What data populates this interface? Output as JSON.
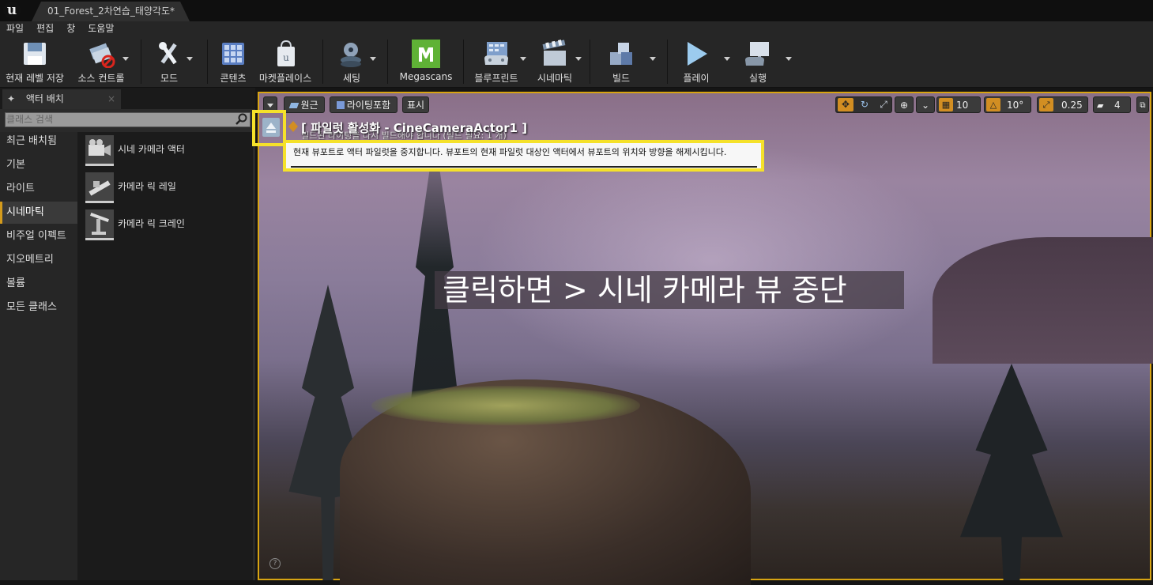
{
  "window": {
    "logo": "u",
    "doc_tab": "01_Forest_2차연습_태양각도*"
  },
  "menu": [
    "파일",
    "편집",
    "창",
    "도움말"
  ],
  "toolbar": {
    "save": "현재 레벨 저장",
    "source_control": "소스 컨트롤",
    "modes": "모드",
    "content": "콘텐츠",
    "marketplace": "마켓플레이스",
    "settings": "세팅",
    "megascans": "Megascans",
    "blueprints": "블루프린트",
    "cinematics": "시네마틱",
    "build": "빌드",
    "play": "플레이",
    "launch": "실행"
  },
  "left_panel": {
    "tab_label": "액터 배치",
    "search_placeholder": "클래스 검색",
    "categories": [
      "최근 배치됨",
      "기본",
      "라이트",
      "시네마틱",
      "비주얼 이펙트",
      "지오메트리",
      "볼륨",
      "모든 클래스"
    ],
    "selected_category": "시네마틱",
    "items": [
      "시네 카메라 액터",
      "카메라 릭 레일",
      "카메라 릭 크레인"
    ]
  },
  "viewport": {
    "perspective": "원근",
    "view_mode": "라이팅포함",
    "show": "표시",
    "grid_snap": "10",
    "rotation_snap": "10°",
    "scale_snap": "0.25",
    "camera_speed": "4",
    "pilot_label": "[ 파일럿 활성화 - CineCameraActor1 ]",
    "pilot_sub": "빌드된 라이팅을 다시 빌드해야 합니다 (빌드 필요: 1 개)",
    "tooltip": "현재 뷰포트로 액터 파일럿을 중지합니다. 뷰포트의 현재 파일럿 대상인 액터에서 뷰포트의 위치와 방향을 해제시킵니다.",
    "caption": "클릭하면 > 시네 카메라 뷰 중단"
  },
  "colors": {
    "accent": "#d8a412",
    "highlight": "#f5e12a",
    "megascans": "#5fb236"
  }
}
